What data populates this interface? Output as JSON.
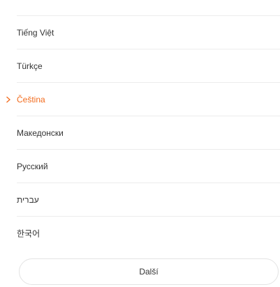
{
  "languages": [
    {
      "label": "Tiếng Việt",
      "selected": false
    },
    {
      "label": "Türkçe",
      "selected": false
    },
    {
      "label": "Čeština",
      "selected": true
    },
    {
      "label": "Македонски",
      "selected": false
    },
    {
      "label": "Русский",
      "selected": false
    },
    {
      "label": "עברית",
      "selected": false
    },
    {
      "label": "한국어",
      "selected": false
    }
  ],
  "selected_indicator_icon": "chevron-right-icon",
  "next_button": {
    "label": "Další"
  },
  "colors": {
    "accent": "#f26b1d",
    "text": "#333333",
    "divider": "#ececec",
    "button_border": "#e3e3e3",
    "background": "#ffffff"
  }
}
